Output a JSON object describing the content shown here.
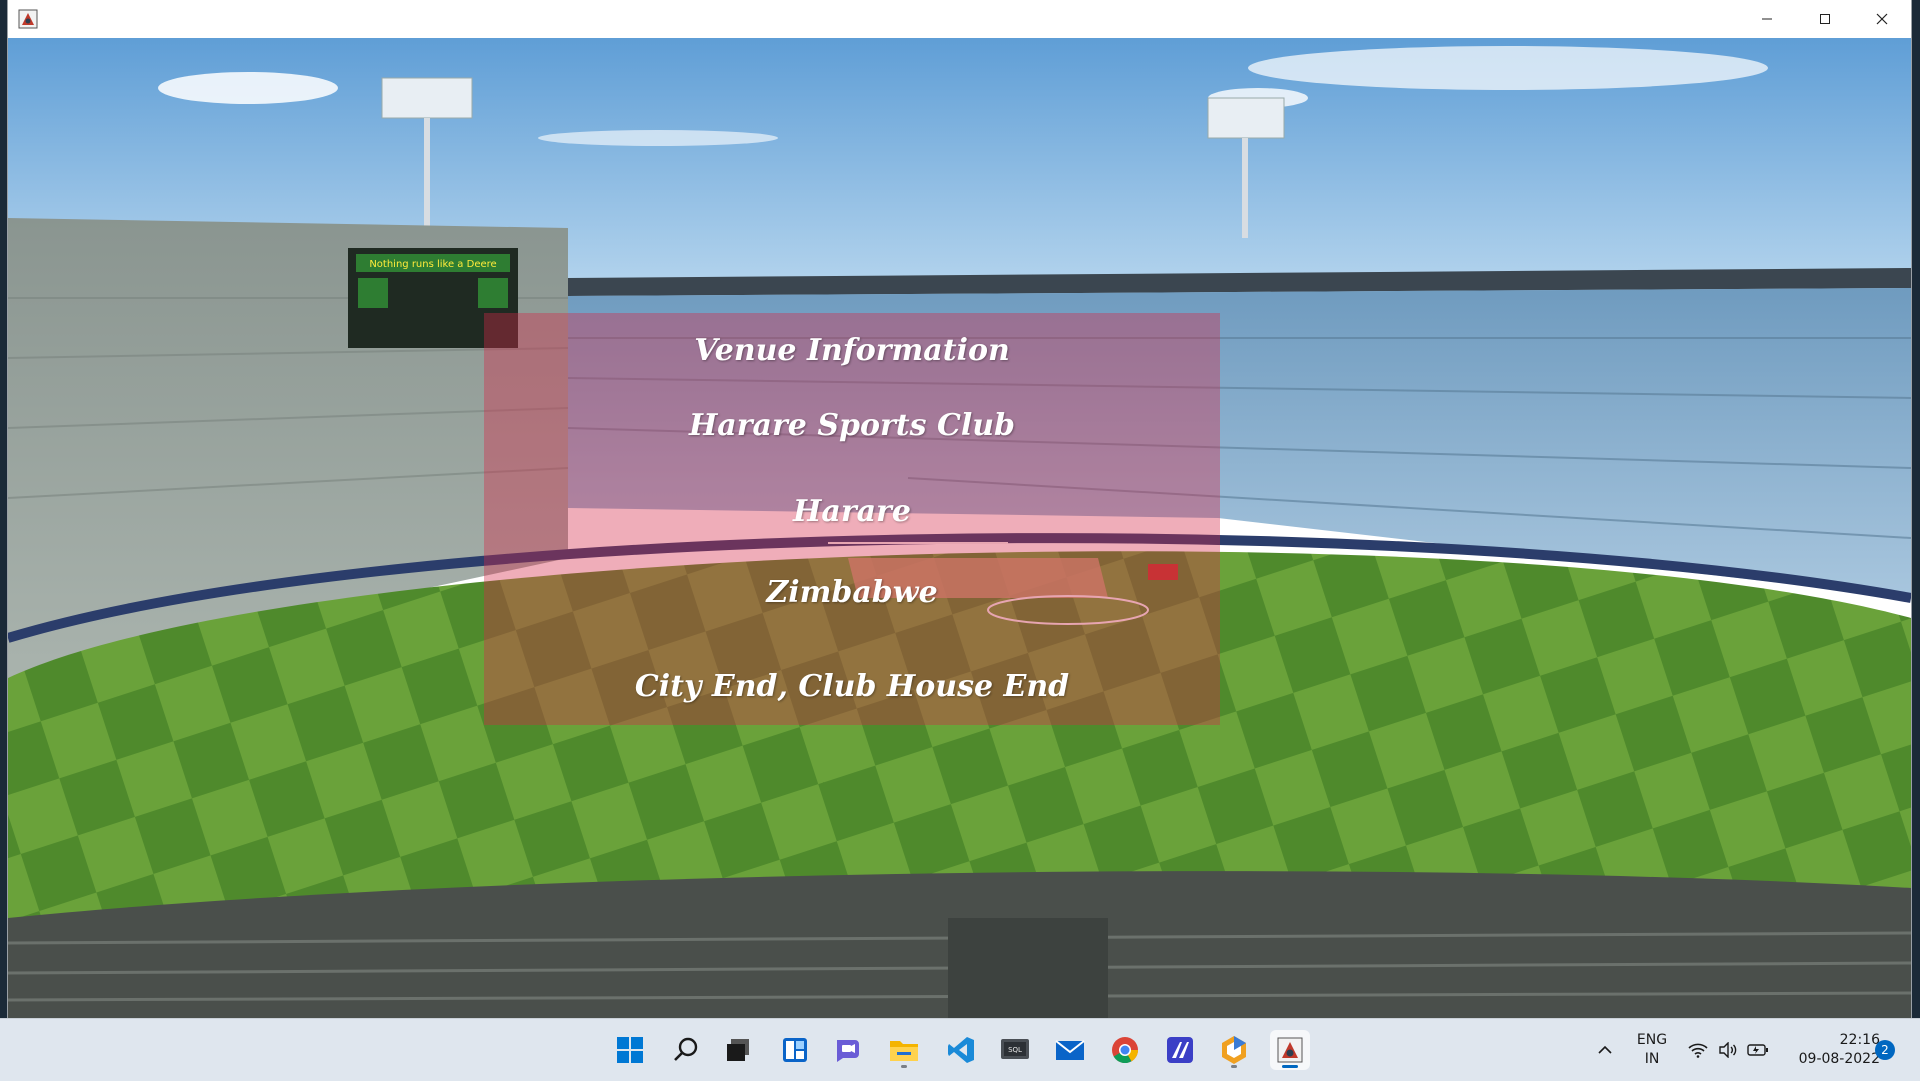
{
  "window": {
    "app_icon": "cricket-app-icon",
    "controls": {
      "minimize": "—",
      "maximize": "☐",
      "close": "✕"
    }
  },
  "panel": {
    "title": "Venue Information",
    "venue_name": "Harare Sports Club",
    "city": "Harare",
    "country": "Zimbabwe",
    "ends": "City End, Club House End"
  },
  "background": {
    "scene": "cricket-stadium-image",
    "scoreboard_text": "Nothing runs like a Deere"
  },
  "taskbar": {
    "apps": [
      {
        "name": "start-icon"
      },
      {
        "name": "search-icon"
      },
      {
        "name": "task-view-icon"
      },
      {
        "name": "widgets-icon"
      },
      {
        "name": "chat-icon"
      },
      {
        "name": "file-explorer-icon"
      },
      {
        "name": "vscode-icon"
      },
      {
        "name": "sql-icon"
      },
      {
        "name": "mail-icon"
      },
      {
        "name": "chrome-icon"
      },
      {
        "name": "editor-icon"
      },
      {
        "name": "hexagon-app-icon"
      },
      {
        "name": "cricket-app-icon"
      }
    ],
    "tray": {
      "lang_line1": "ENG",
      "lang_line2": "IN",
      "time": "22:16",
      "date": "09-08-2022",
      "notifications": "2"
    }
  },
  "colors": {
    "panel_overlay": "#d62846",
    "taskbar_bg": "#dfe6ee",
    "accent": "#0067c0"
  }
}
